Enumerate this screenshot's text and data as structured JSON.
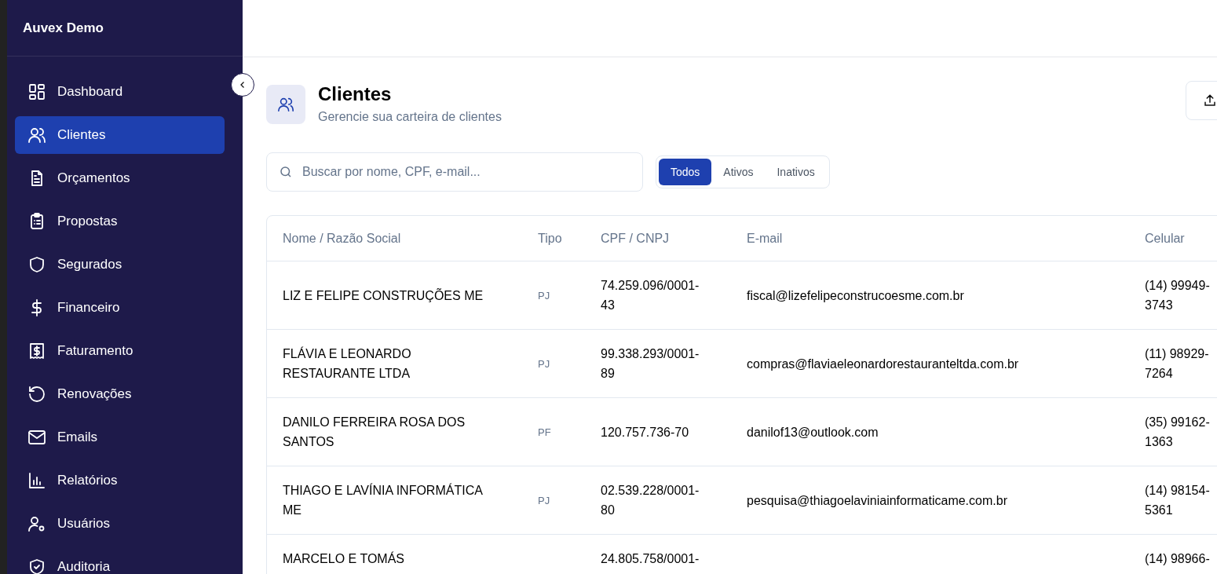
{
  "app": {
    "name": "Auvex Demo"
  },
  "sidebar": {
    "items": [
      {
        "label": "Dashboard",
        "selected": false
      },
      {
        "label": "Clientes",
        "selected": true
      },
      {
        "label": "Orçamentos",
        "selected": false
      },
      {
        "label": "Propostas",
        "selected": false
      },
      {
        "label": "Segurados",
        "selected": false
      },
      {
        "label": "Financeiro",
        "selected": false
      },
      {
        "label": "Faturamento",
        "selected": false
      },
      {
        "label": "Renovações",
        "selected": false
      },
      {
        "label": "Emails",
        "selected": false
      },
      {
        "label": "Relatórios",
        "selected": false
      },
      {
        "label": "Usuários",
        "selected": false
      },
      {
        "label": "Auditoria",
        "selected": false
      }
    ]
  },
  "page": {
    "title": "Clientes",
    "subtitle": "Gerencie sua carteira de clientes"
  },
  "search": {
    "placeholder": "Buscar por nome, CPF, e-mail..."
  },
  "filters": [
    {
      "label": "Todos",
      "selected": true
    },
    {
      "label": "Ativos",
      "selected": false
    },
    {
      "label": "Inativos",
      "selected": false
    }
  ],
  "table": {
    "columns": [
      "Nome / Razão Social",
      "Tipo",
      "CPF / CNPJ",
      "E-mail",
      "Celular"
    ],
    "rows": [
      [
        "LIZ E FELIPE CONSTRUÇÕES ME",
        "PJ",
        "74.259.096/0001-43",
        "fiscal@lizefelipeconstrucoesme.com.br",
        "(14) 99949-3743"
      ],
      [
        "FLÁVIA E LEONARDO RESTAURANTE LTDA",
        "PJ",
        "99.338.293/0001-89",
        "compras@flaviaeleonardorestauranteltda.com.br",
        "(11) 98929-7264"
      ],
      [
        "DANILO FERREIRA ROSA DOS SANTOS",
        "PF",
        "120.757.736-70",
        "danilof13@outlook.com",
        "(35) 99162-1363"
      ],
      [
        "THIAGO E LAVÍNIA INFORMÁTICA ME",
        "PJ",
        "02.539.228/0001-80",
        "pesquisa@thiagoelaviniainformaticame.com.br",
        "(14) 98154-5361"
      ],
      [
        "MARCELO E TOMÁS",
        "",
        "24.805.758/0001-",
        "",
        "(14) 98966-"
      ]
    ]
  }
}
